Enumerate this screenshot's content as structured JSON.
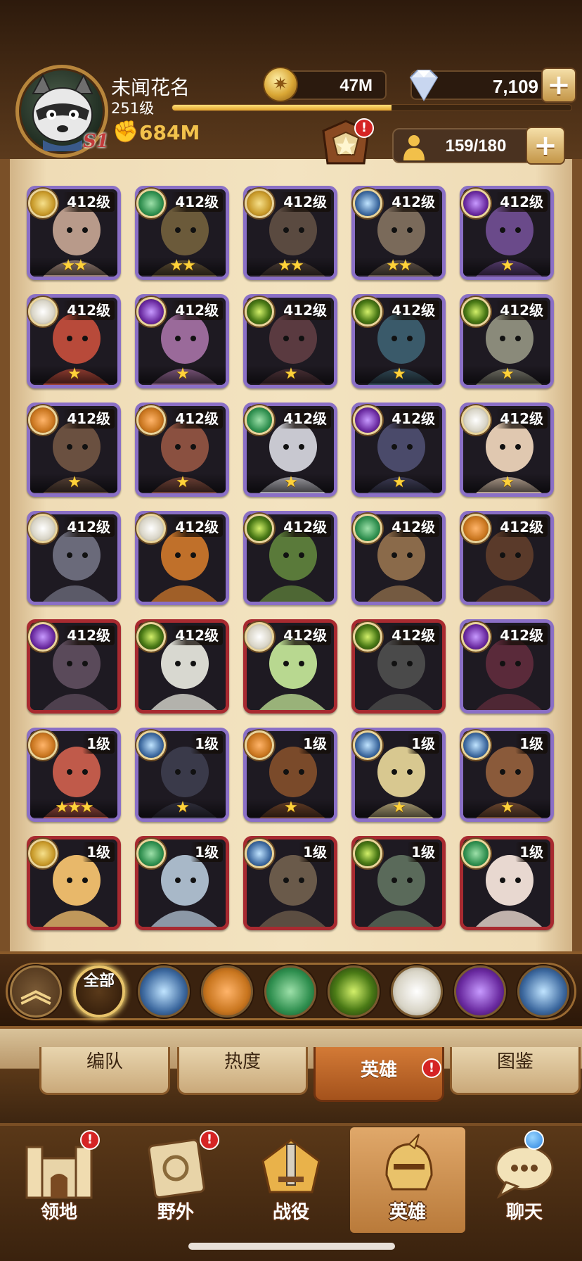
{
  "player": {
    "name": "未闻花名",
    "level": "251级",
    "server": "S1",
    "power": "684M",
    "xp_progress": 0.55
  },
  "resources": {
    "gold": "47M",
    "gems": "7,109"
  },
  "roster": {
    "capacity": "159/180"
  },
  "heroes": [
    {
      "level": "412级",
      "stars": "★★",
      "faction": "lightbearer",
      "frame": "purple",
      "art": "#b89a8a"
    },
    {
      "level": "412级",
      "stars": "★★",
      "faction": "wilder",
      "frame": "purple",
      "art": "#6b5a3a"
    },
    {
      "level": "412级",
      "stars": "★★",
      "faction": "lightbearer",
      "frame": "purple",
      "art": "#5a4a40"
    },
    {
      "level": "412级",
      "stars": "★★",
      "faction": "dimensional",
      "frame": "purple",
      "art": "#7a6a5a"
    },
    {
      "level": "412级",
      "stars": "★",
      "faction": "hypogean",
      "frame": "purple",
      "art": "#6a4a8a"
    },
    {
      "level": "412级",
      "stars": "★",
      "faction": "celestial",
      "frame": "purple",
      "art": "#b84a3a"
    },
    {
      "level": "412级",
      "stars": "★",
      "faction": "hypogean",
      "frame": "purple",
      "art": "#9a6a9a"
    },
    {
      "level": "412级",
      "stars": "★",
      "faction": "graveborn",
      "frame": "purple",
      "art": "#5a3a40"
    },
    {
      "level": "412级",
      "stars": "★",
      "faction": "graveborn",
      "frame": "purple",
      "art": "#3a5a6a"
    },
    {
      "level": "412级",
      "stars": "★",
      "faction": "graveborn",
      "frame": "purple",
      "art": "#8a8a7a"
    },
    {
      "level": "412级",
      "stars": "★",
      "faction": "mauler",
      "frame": "purple",
      "art": "#6a5040"
    },
    {
      "level": "412级",
      "stars": "★",
      "faction": "mauler",
      "frame": "purple",
      "art": "#8a5040"
    },
    {
      "level": "412级",
      "stars": "★",
      "faction": "wilder",
      "frame": "purple",
      "art": "#c8c8d0"
    },
    {
      "level": "412级",
      "stars": "★",
      "faction": "hypogean",
      "frame": "purple",
      "art": "#4a4a6a"
    },
    {
      "level": "412级",
      "stars": "★",
      "faction": "celestial",
      "frame": "purple",
      "art": "#e0c8b0"
    },
    {
      "level": "412级",
      "stars": "",
      "faction": "celestial",
      "frame": "purple",
      "art": "#6a6a7a"
    },
    {
      "level": "412级",
      "stars": "",
      "faction": "celestial",
      "frame": "purple",
      "art": "#c0702a"
    },
    {
      "level": "412级",
      "stars": "",
      "faction": "graveborn",
      "frame": "purple",
      "art": "#5a7a3a"
    },
    {
      "level": "412级",
      "stars": "",
      "faction": "wilder",
      "frame": "purple",
      "art": "#8a6a4a"
    },
    {
      "level": "412级",
      "stars": "",
      "faction": "mauler",
      "frame": "purple",
      "art": "#5a3a2a"
    },
    {
      "level": "412级",
      "stars": "",
      "faction": "hypogean",
      "frame": "red",
      "art": "#5a4a5a"
    },
    {
      "level": "412级",
      "stars": "",
      "faction": "graveborn",
      "frame": "red",
      "art": "#d8d8d0"
    },
    {
      "level": "412级",
      "stars": "",
      "faction": "celestial",
      "frame": "red",
      "art": "#b8d890"
    },
    {
      "level": "412级",
      "stars": "",
      "faction": "graveborn",
      "frame": "red",
      "art": "#4a4a4a"
    },
    {
      "level": "412级",
      "stars": "",
      "faction": "hypogean",
      "frame": "purple",
      "art": "#5a2a3a"
    },
    {
      "level": "1级",
      "stars": "★★★",
      "faction": "mauler",
      "frame": "purple",
      "art": "#c05a4a"
    },
    {
      "level": "1级",
      "stars": "★",
      "faction": "dimensional",
      "frame": "purple",
      "art": "#3a3a4a"
    },
    {
      "level": "1级",
      "stars": "★",
      "faction": "mauler",
      "frame": "purple",
      "art": "#7a4a2a"
    },
    {
      "level": "1级",
      "stars": "★",
      "faction": "dimensional",
      "frame": "purple",
      "art": "#d8c890"
    },
    {
      "level": "1级",
      "stars": "★",
      "faction": "dimensional",
      "frame": "purple",
      "art": "#8a5a3a"
    },
    {
      "level": "1级",
      "stars": "",
      "faction": "lightbearer",
      "frame": "red",
      "art": "#e8b86a"
    },
    {
      "level": "1级",
      "stars": "",
      "faction": "wilder",
      "frame": "red",
      "art": "#a8b8c8"
    },
    {
      "level": "1级",
      "stars": "",
      "faction": "dimensional",
      "frame": "red",
      "art": "#6a5a4a"
    },
    {
      "level": "1级",
      "stars": "",
      "faction": "graveborn",
      "frame": "red",
      "art": "#5a6a5a"
    },
    {
      "level": "1级",
      "stars": "",
      "faction": "wilder",
      "frame": "red",
      "art": "#e8d8d0"
    }
  ],
  "filters": {
    "all_label": "全部",
    "factions": [
      "dimensional",
      "mauler",
      "wilder",
      "graveborn",
      "celestial",
      "hypogean",
      "dimensional-2"
    ]
  },
  "subtabs": [
    {
      "label": "编队"
    },
    {
      "label": "热度"
    },
    {
      "label": "英雄"
    },
    {
      "label": "图鉴"
    }
  ],
  "nav": [
    {
      "label": "领地",
      "icon": "castle-icon",
      "alert": "!"
    },
    {
      "label": "野外",
      "icon": "map-scroll-icon",
      "alert": "!"
    },
    {
      "label": "战役",
      "icon": "battle-sword-icon",
      "alert": ""
    },
    {
      "label": "英雄",
      "icon": "helmet-icon",
      "alert": ""
    },
    {
      "label": "聊天",
      "icon": "chat-icon",
      "alert": ""
    }
  ],
  "alerts": {
    "mark": "!"
  }
}
